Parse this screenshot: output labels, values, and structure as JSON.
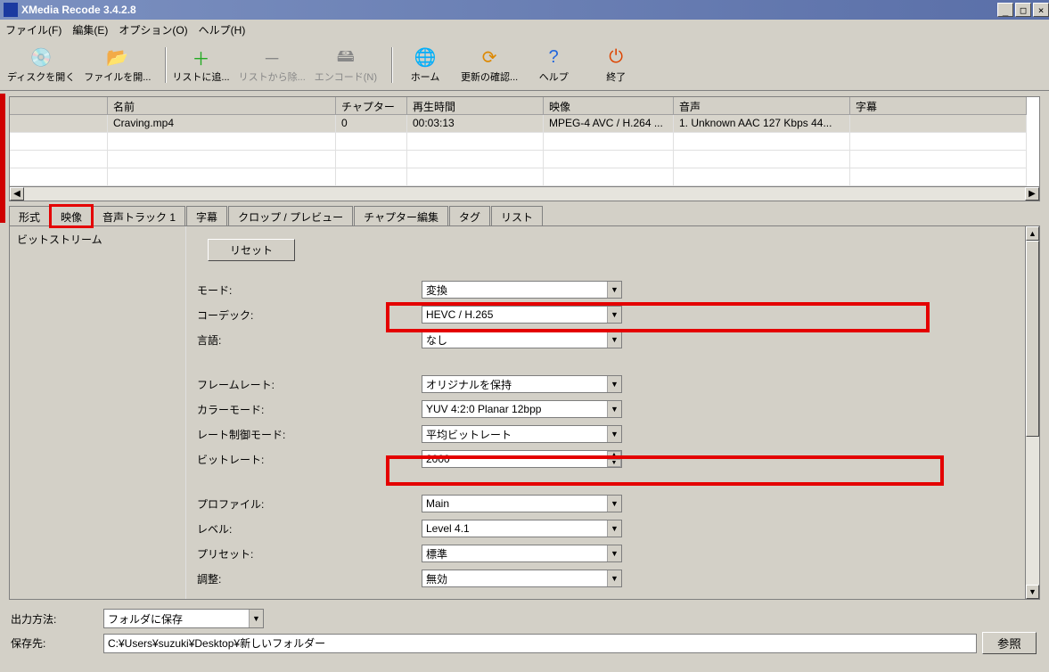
{
  "title": "XMedia Recode 3.4.2.8",
  "menu": {
    "file": "ファイル(F)",
    "edit": "編集(E)",
    "options": "オプション(O)",
    "help": "ヘルプ(H)"
  },
  "toolbar": {
    "open_disc": "ディスクを開く",
    "open_file": "ファイルを開...",
    "add_list": "リストに追...",
    "remove_list": "リストから除...",
    "encode": "エンコード(N)",
    "home": "ホーム",
    "check_update": "更新の確認...",
    "help": "ヘルプ",
    "exit": "終了"
  },
  "filelist": {
    "headers": {
      "c0": "",
      "c1": "名前",
      "c2": "チャプター",
      "c3": "再生時間",
      "c4": "映像",
      "c5": "音声",
      "c6": "字幕"
    },
    "rows": [
      {
        "c0": "",
        "c1": "Craving.mp4",
        "c2": "0",
        "c3": "00:03:13",
        "c4": "MPEG-4 AVC / H.264 ...",
        "c5": "1. Unknown AAC  127 Kbps 44...",
        "c6": ""
      }
    ]
  },
  "tabs": {
    "format": "形式",
    "video": "映像",
    "audio": "音声トラック 1",
    "subtitle": "字幕",
    "crop": "クロップ / プレビュー",
    "chapter": "チャプター編集",
    "tag": "タグ",
    "list": "リスト"
  },
  "tree": {
    "root": "ビットストリーム"
  },
  "form": {
    "reset": "リセット",
    "mode_lbl": "モード:",
    "mode_val": "変換",
    "codec_lbl": "コーデック:",
    "codec_val": "HEVC / H.265",
    "lang_lbl": "言語:",
    "lang_val": "なし",
    "fps_lbl": "フレームレート:",
    "fps_val": "オリジナルを保持",
    "color_lbl": "カラーモード:",
    "color_val": "YUV 4:2:0 Planar 12bpp",
    "rate_lbl": "レート制御モード:",
    "rate_val": "平均ビットレート",
    "bitrate_lbl": "ビットレート:",
    "bitrate_val": "2000",
    "profile_lbl": "プロファイル:",
    "profile_val": "Main",
    "level_lbl": "レベル:",
    "level_val": "Level 4.1",
    "preset_lbl": "プリセット:",
    "preset_val": "標準",
    "tune_lbl": "調整:",
    "tune_val": "無効"
  },
  "bottom": {
    "method_lbl": "出力方法:",
    "method_val": "フォルダに保存",
    "dest_lbl": "保存先:",
    "dest_val": "C:¥Users¥suzuki¥Desktop¥新しいフォルダー",
    "browse": "参照"
  }
}
